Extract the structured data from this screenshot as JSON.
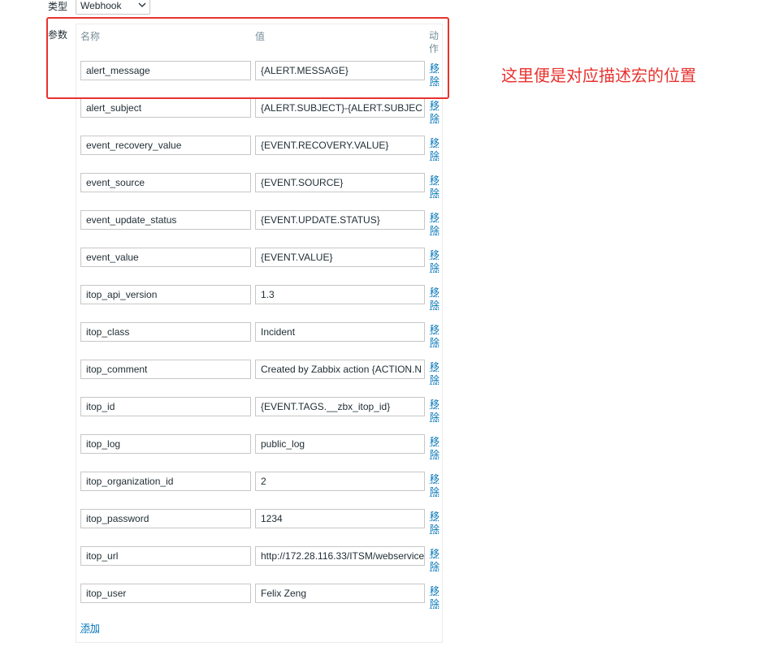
{
  "form": {
    "type_label": "类型",
    "type_value": "Webhook",
    "params_label": "参数",
    "headers": {
      "name": "名称",
      "value": "值",
      "action": "动作"
    },
    "remove_label": "移除",
    "add_label": "添加",
    "params": [
      {
        "name": "alert_message",
        "value": "{ALERT.MESSAGE}"
      },
      {
        "name": "alert_subject",
        "value": "{ALERT.SUBJECT}-{ALERT.SUBJEC"
      },
      {
        "name": "event_recovery_value",
        "value": "{EVENT.RECOVERY.VALUE}"
      },
      {
        "name": "event_source",
        "value": "{EVENT.SOURCE}"
      },
      {
        "name": "event_update_status",
        "value": "{EVENT.UPDATE.STATUS}"
      },
      {
        "name": "event_value",
        "value": "{EVENT.VALUE}"
      },
      {
        "name": "itop_api_version",
        "value": "1.3"
      },
      {
        "name": "itop_class",
        "value": "Incident"
      },
      {
        "name": "itop_comment",
        "value": "Created by Zabbix action {ACTION.N"
      },
      {
        "name": "itop_id",
        "value": "{EVENT.TAGS.__zbx_itop_id}"
      },
      {
        "name": "itop_log",
        "value": "public_log"
      },
      {
        "name": "itop_organization_id",
        "value": "2"
      },
      {
        "name": "itop_password",
        "value": "1234"
      },
      {
        "name": "itop_url",
        "value": "http://172.28.116.33/ITSM/webservice"
      },
      {
        "name": "itop_user",
        "value": "Felix Zeng"
      }
    ]
  },
  "annotation": {
    "text": "这里便是对应描述宏的位置",
    "color": "#e8322e"
  },
  "colors": {
    "link": "#0275b8",
    "border": "#c7c7c7",
    "header": "#768d99"
  }
}
